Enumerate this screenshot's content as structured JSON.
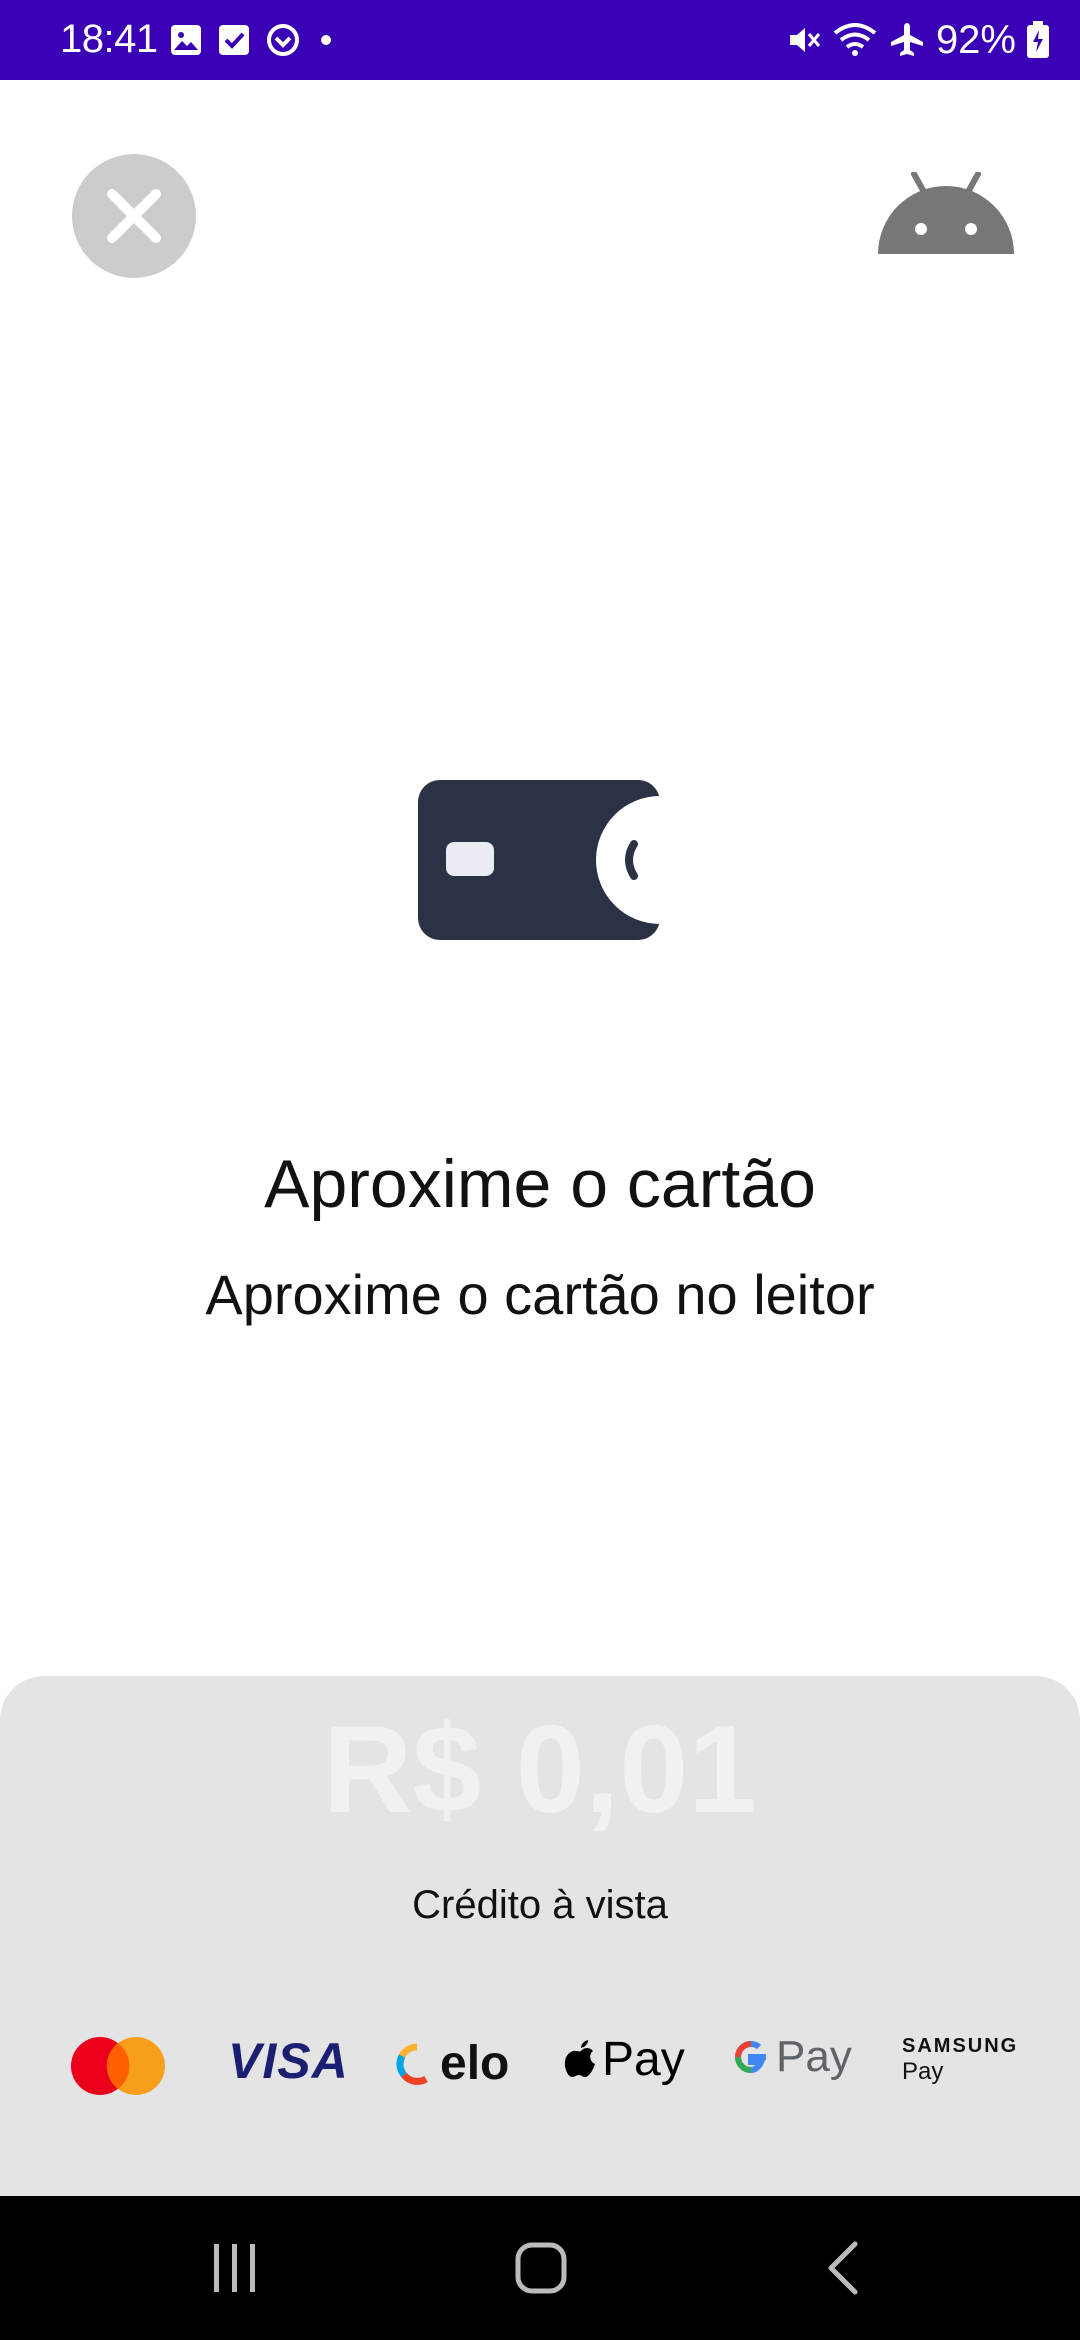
{
  "status_bar": {
    "time": "18:41",
    "battery": "92%",
    "background_color": "#3a00b5",
    "left_icons": [
      "image-icon",
      "checkbox-icon",
      "sync-icon",
      "dot-icon"
    ],
    "right_icons": [
      "mute-icon",
      "wifi-icon",
      "airplane-icon",
      "battery-icon"
    ]
  },
  "header": {
    "close_icon": "close-icon",
    "android_icon": "android-icon"
  },
  "main": {
    "icon": "contactless-card-icon",
    "title": "Aproxime o cartão",
    "subtitle": "Aproxime o cartão no leitor"
  },
  "payment": {
    "amount": "R$ 0,01",
    "type": "Crédito à vista",
    "brands": {
      "mastercard": "mastercard-logo",
      "visa": "VISA",
      "elo": "elo",
      "apple_pay": "Pay",
      "google_pay": "Pay",
      "samsung_pay_top": "SAMSUNG",
      "samsung_pay_bottom": "Pay"
    }
  },
  "nav_bar": {
    "buttons": [
      "recents-icon",
      "home-icon",
      "back-icon"
    ]
  }
}
